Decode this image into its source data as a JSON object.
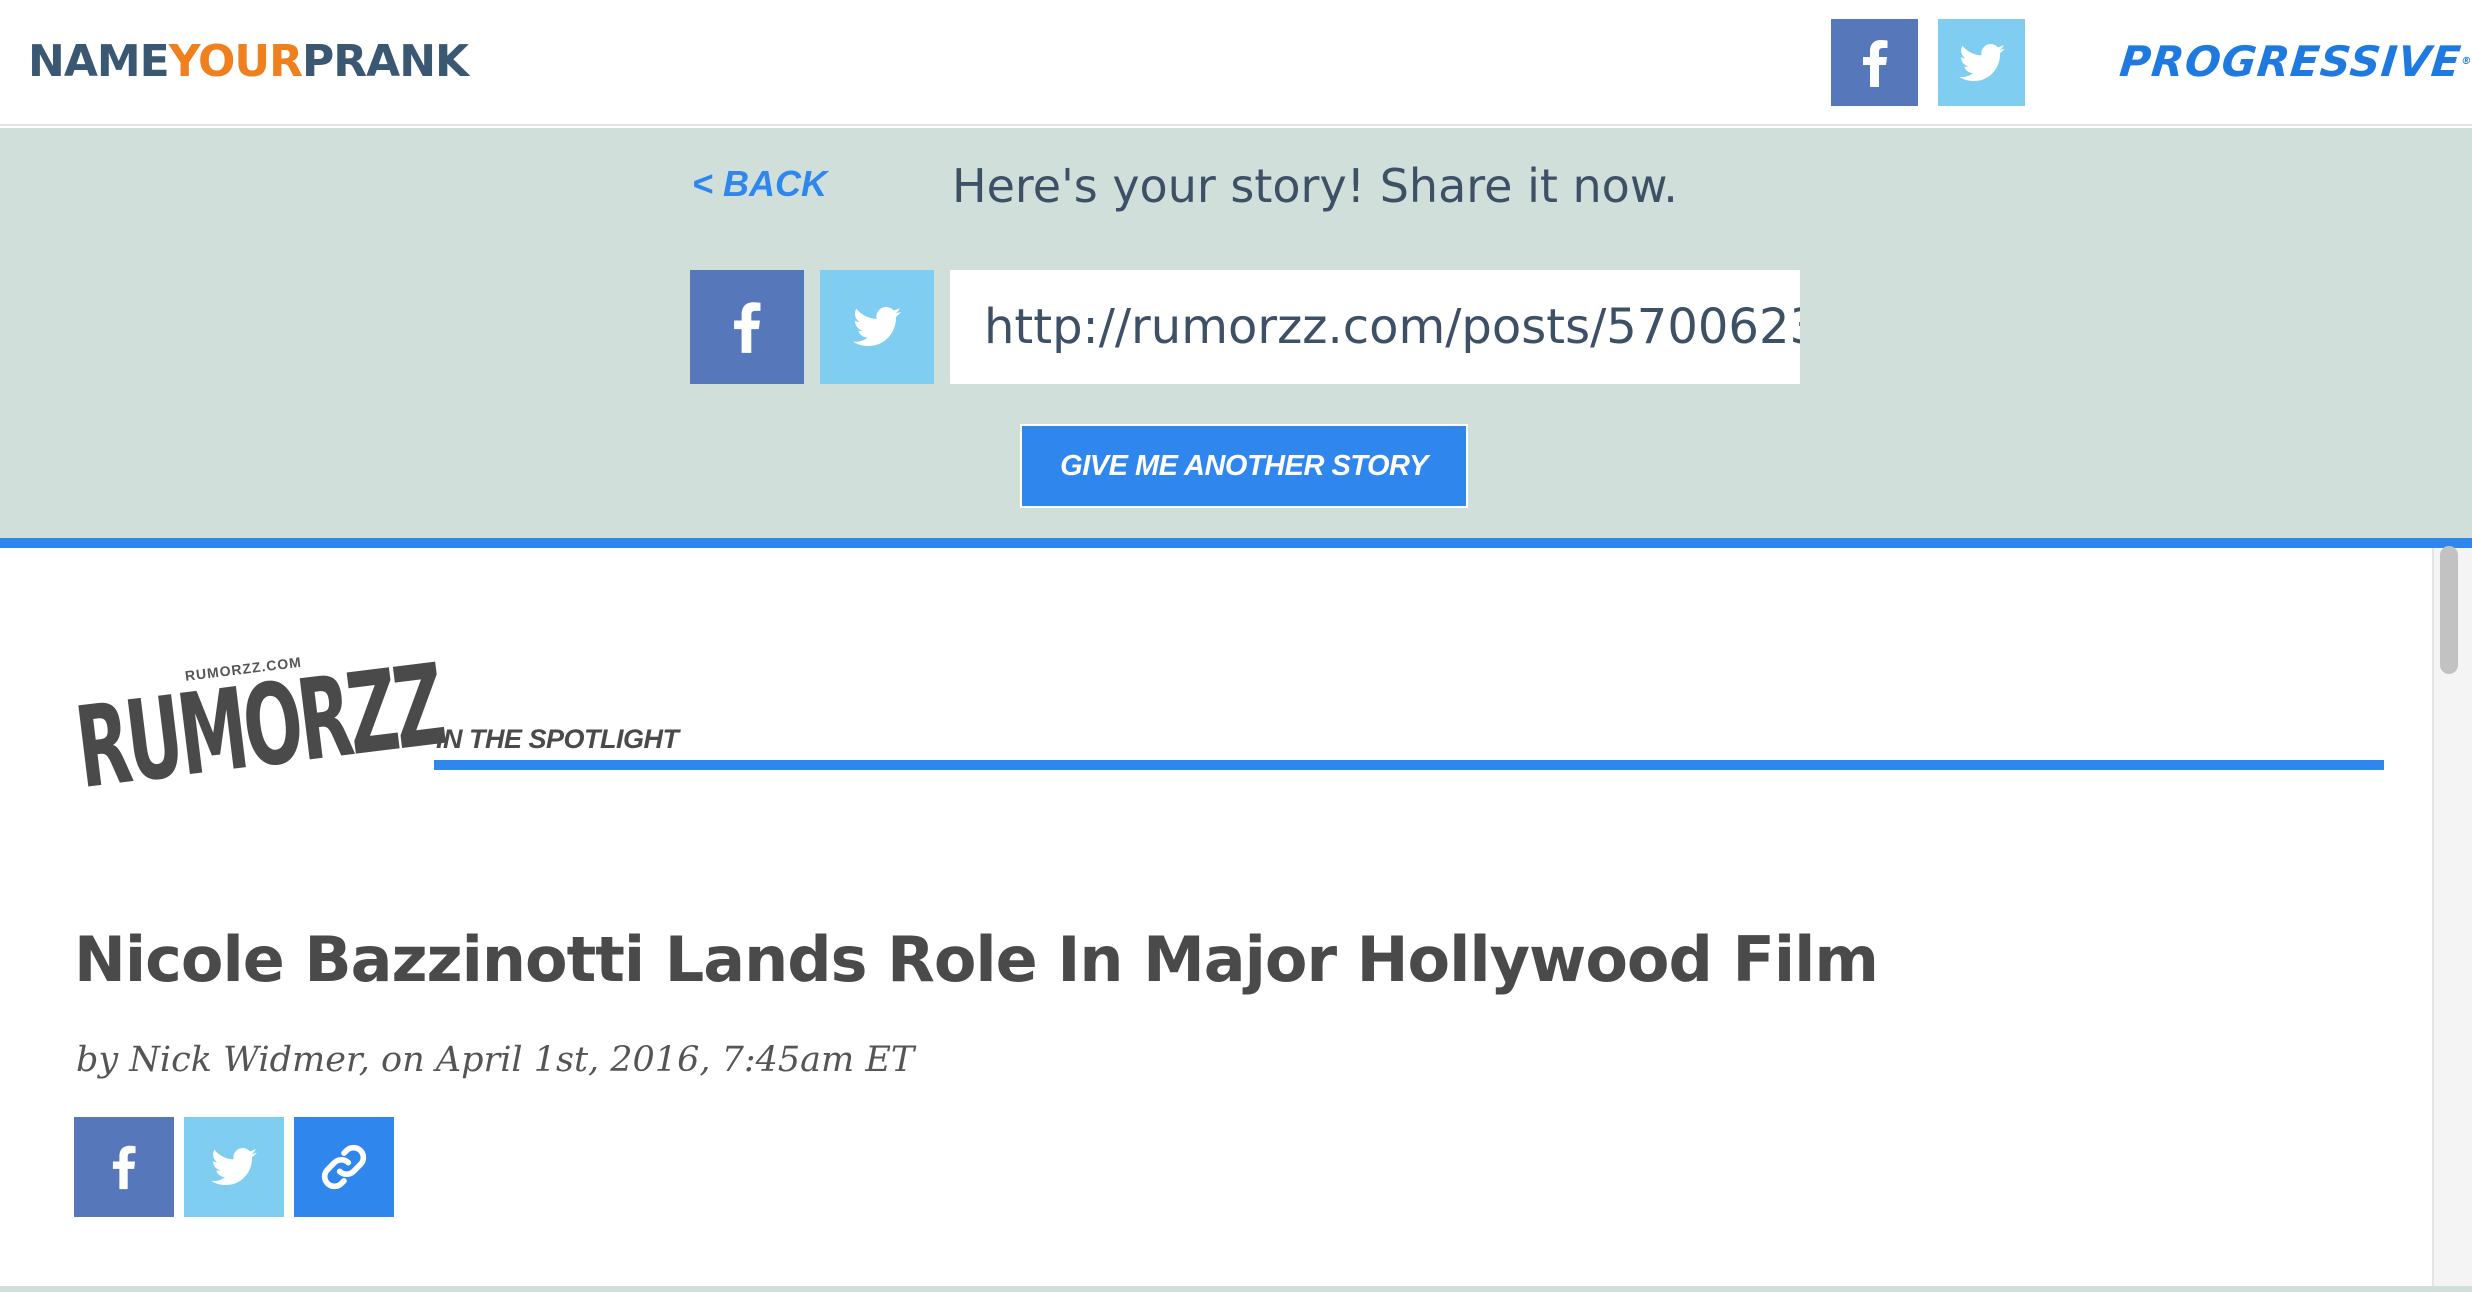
{
  "header": {
    "brand_part1": "NAME",
    "brand_part2": "YOUR",
    "brand_part3": "PRANK",
    "facebook_icon": "facebook-icon",
    "twitter_icon": "twitter-icon",
    "sponsor": "PROGRESSIVE",
    "sponsor_mark": "®"
  },
  "share_panel": {
    "back_label": "< BACK",
    "headline": "Here's your story! Share it now.",
    "facebook_icon": "facebook-icon",
    "twitter_icon": "twitter-icon",
    "url_value": "http://rumorzz.com/posts/5700623",
    "another_story_label": "GIVE ME ANOTHER STORY"
  },
  "article": {
    "logo_domain": "RUMORZZ.COM",
    "logo_name": "RUMORZZ",
    "section_label": "IN THE SPOTLIGHT",
    "title": "Nicole Bazzinotti Lands Role In Major Hollywood Film",
    "byline": "by Nick Widmer, on April 1st, 2016, 7:45am ET",
    "share_icons": [
      "facebook-icon",
      "twitter-icon",
      "link-icon"
    ]
  },
  "colors": {
    "brand_blue": "#3b5872",
    "brand_orange": "#f07f1e",
    "accent_blue": "#2f86ec",
    "facebook": "#5777bb",
    "twitter": "#7fcef1",
    "panel_bg": "#d1dfdb",
    "text_dark": "#4a4a4a"
  }
}
